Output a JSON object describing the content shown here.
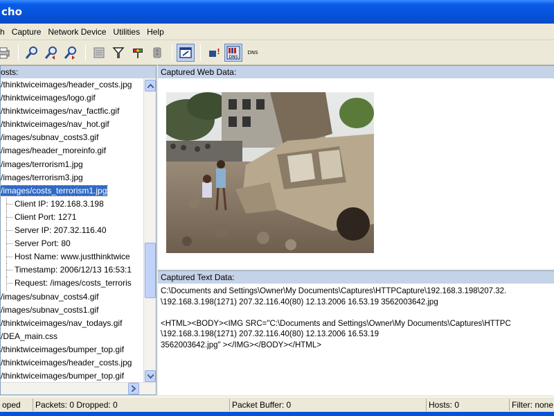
{
  "window": {
    "title": "cho"
  },
  "menu": [
    {
      "label": "h"
    },
    {
      "label": "Capture"
    },
    {
      "label": "Network Device"
    },
    {
      "label": "Utilities"
    },
    {
      "label": "Help"
    }
  ],
  "toolbar": {
    "dns_label_1": "DNS",
    "dns_label_2": "DNS",
    "icons": [
      "printer-icon",
      "search-icon",
      "search-previous-icon",
      "search-next-icon",
      "clear-icon",
      "filter-icon",
      "traffic-light-icon",
      "stop-light-icon",
      "capture-window-icon",
      "alert-icon",
      "dns-icon",
      "dns-text-icon"
    ]
  },
  "hosts": {
    "header": "osts:",
    "rows": [
      {
        "text": "/thinktwiceimages/header_costs.jpg",
        "child": false,
        "selected": false
      },
      {
        "text": "/thinktwiceimages/logo.gif",
        "child": false,
        "selected": false
      },
      {
        "text": "/thinktwiceimages/nav_factfic.gif",
        "child": false,
        "selected": false
      },
      {
        "text": "/thinktwiceimages/nav_hot.gif",
        "child": false,
        "selected": false
      },
      {
        "text": "/images/subnav_costs3.gif",
        "child": false,
        "selected": false
      },
      {
        "text": "/images/header_moreinfo.gif",
        "child": false,
        "selected": false
      },
      {
        "text": "/images/terrorism1.jpg",
        "child": false,
        "selected": false
      },
      {
        "text": "/images/terrorism3.jpg",
        "child": false,
        "selected": false
      },
      {
        "text": "/images/costs_terrorism1.jpg",
        "child": false,
        "selected": true
      },
      {
        "text": "Client IP: 192.168.3.198",
        "child": true,
        "selected": false
      },
      {
        "text": "Client Port: 1271",
        "child": true,
        "selected": false
      },
      {
        "text": "Server IP: 207.32.116.40",
        "child": true,
        "selected": false
      },
      {
        "text": "Server Port: 80",
        "child": true,
        "selected": false
      },
      {
        "text": "Host Name: www.justthinktwice",
        "child": true,
        "selected": false
      },
      {
        "text": "Timestamp: 2006/12/13 16:53:1",
        "child": true,
        "selected": false
      },
      {
        "text": "Request: /images/costs_terroris",
        "child": true,
        "selected": false
      },
      {
        "text": "/images/subnav_costs4.gif",
        "child": false,
        "selected": false
      },
      {
        "text": "/images/subnav_costs1.gif",
        "child": false,
        "selected": false
      },
      {
        "text": "/thinktwiceimages/nav_todays.gif",
        "child": false,
        "selected": false
      },
      {
        "text": "/DEA_main.css",
        "child": false,
        "selected": false
      },
      {
        "text": "/thinktwiceimages/bumper_top.gif",
        "child": false,
        "selected": false
      },
      {
        "text": "/thinktwiceimages/header_costs.jpg",
        "child": false,
        "selected": false
      },
      {
        "text": "/thinktwiceimages/bumper_top.gif",
        "child": false,
        "selected": false
      }
    ]
  },
  "web_data": {
    "header": "Captured Web Data:"
  },
  "text_data": {
    "header": "Captured Text Data:",
    "lines": [
      "C:\\Documents and Settings\\Owner\\My Documents\\Captures\\HTTPCapture\\192.168.3.198\\207.32.",
      "\\192.168.3.198(1271) 207.32.116.40(80) 12.13.2006 16.53.19 3562003642.jpg",
      "",
      "<HTML><BODY><IMG SRC=\"C:\\Documents and Settings\\Owner\\My Documents\\Captures\\HTTPC",
      "\\192.168.3.198(1271) 207.32.116.40(80) 12.13.2006 16.53.19",
      "3562003642.jpg\" ></IMG></BODY></HTML>"
    ]
  },
  "status": {
    "state": "oped",
    "packets": "Packets: 0 Dropped: 0",
    "buffer": "Packet Buffer: 0",
    "hosts": "Hosts: 0",
    "filter": "Filter: none"
  }
}
